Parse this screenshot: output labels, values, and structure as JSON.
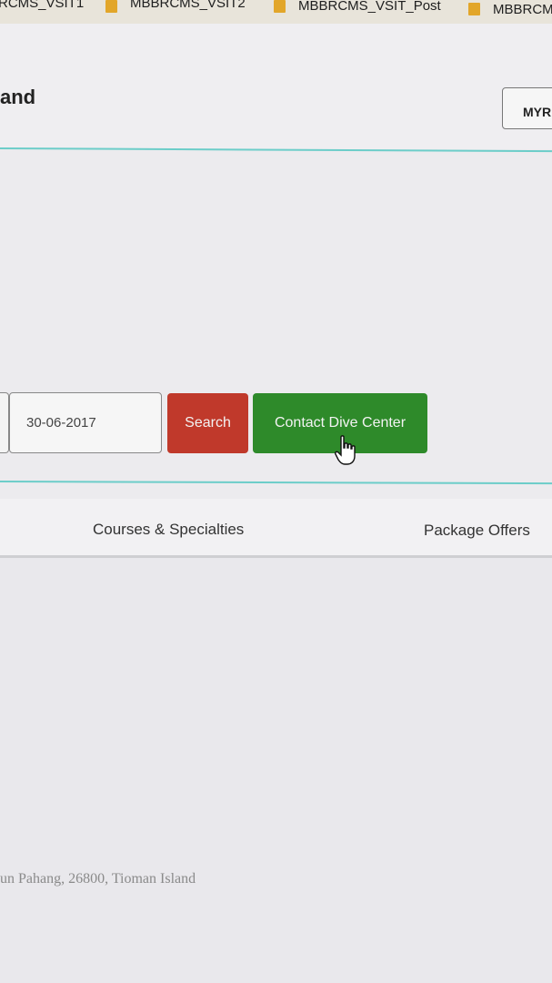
{
  "bookmarks": [
    {
      "label": "RCMS_VSIT1"
    },
    {
      "label": "MBBRCMS_VSIT2"
    },
    {
      "label": "MBBRCMS_VSIT_Post"
    },
    {
      "label": "MBBRCM"
    }
  ],
  "header": {
    "title_fragment": "and",
    "currency_label": "MYR"
  },
  "search_bar": {
    "date_value": "30-06-2017",
    "search_label": "Search",
    "contact_label": "Contact Dive Center"
  },
  "tabs": [
    {
      "label": "Courses & Specialties"
    },
    {
      "label": "Package Offers"
    }
  ],
  "footer": {
    "address": "un Pahang, 26800, Tioman Island"
  },
  "colors": {
    "accent_line": "#6ccdc9",
    "search_button": "#c0392b",
    "contact_button": "#2e8a2a",
    "bookmark_folder": "#e2a62a"
  }
}
